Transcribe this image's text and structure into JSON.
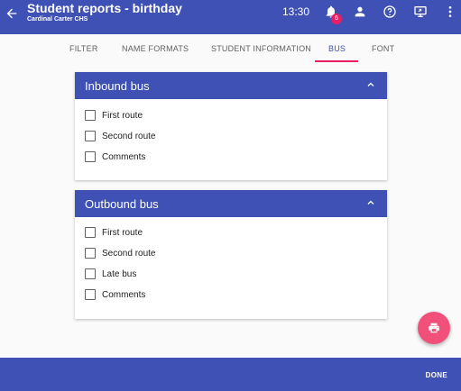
{
  "header": {
    "back_icon": "arrow-left-icon",
    "title": "Student reports - birthday",
    "subtitle": "Cardinal Carter CHS",
    "time": "13:30",
    "notification_count": "6",
    "icons": [
      "bell-icon",
      "person-icon",
      "help-circle-icon",
      "screen-share-icon",
      "more-vert-icon"
    ]
  },
  "tabs": [
    {
      "label": "FILTER"
    },
    {
      "label": "NAME FORMATS"
    },
    {
      "label": "STUDENT INFORMATION"
    },
    {
      "label": "BUS"
    },
    {
      "label": "FONT"
    }
  ],
  "active_tab": "BUS",
  "inbound": {
    "title": "Inbound bus",
    "options": [
      {
        "label": "First route",
        "checked": false
      },
      {
        "label": "Second route",
        "checked": false
      },
      {
        "label": "Comments",
        "checked": false
      }
    ]
  },
  "outbound": {
    "title": "Outbound bus",
    "options": [
      {
        "label": "First route",
        "checked": false
      },
      {
        "label": "Second route",
        "checked": false
      },
      {
        "label": "Late bus",
        "checked": false
      },
      {
        "label": "Comments",
        "checked": false
      }
    ]
  },
  "fab_icon": "print-icon",
  "footer": {
    "done_label": "DONE"
  },
  "colors": {
    "primary": "#3f51b5",
    "accent": "#e91e63",
    "fab": "#f0507a"
  }
}
